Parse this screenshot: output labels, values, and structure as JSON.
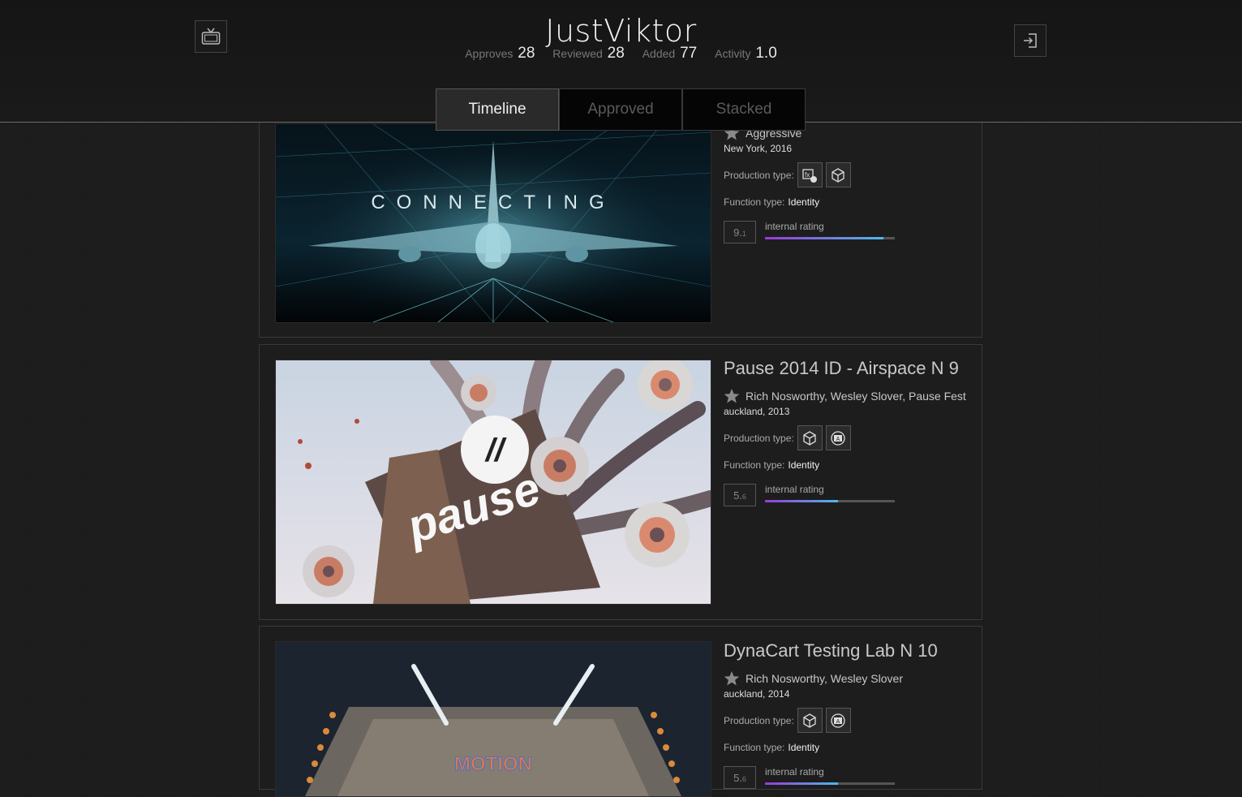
{
  "header": {
    "username": "JustViktor",
    "stats": [
      {
        "label": "Approves",
        "value": "28"
      },
      {
        "label": "Reviewed",
        "value": "28"
      },
      {
        "label": "Added",
        "value": "77"
      },
      {
        "label": "Activity",
        "value": "1.0"
      }
    ],
    "left_icon": "tv-icon",
    "right_icon": "login-icon"
  },
  "tabs": [
    "Timeline",
    "Approved",
    "Stacked"
  ],
  "active_tab": "Timeline",
  "labels": {
    "production_type": "Production type:",
    "function_type": "Function type:",
    "internal_rating": "internal rating"
  },
  "items": [
    {
      "title": "",
      "authors": "Aggressive",
      "place": "New York, 2016",
      "production_icons": [
        "fx-icon",
        "3d-cube-icon"
      ],
      "function_type": "Identity",
      "rating_major": "9.",
      "rating_minor": "1",
      "rating_value": 9.1,
      "thumbnail_text": "CONNECTING"
    },
    {
      "title": "Pause 2014 ID - Airspace N 9",
      "authors": "Rich Nosworthy, Wesley Slover, Pause Fest",
      "place": "auckland, 2013",
      "production_icons": [
        "3d-cube-icon",
        "after-effects-icon"
      ],
      "function_type": "Identity",
      "rating_major": "5.",
      "rating_minor": "6",
      "rating_value": 5.6,
      "thumbnail_text": "pause"
    },
    {
      "title": "DynaCart Testing Lab N 10",
      "authors": "Rich Nosworthy, Wesley Slover",
      "place": "auckland, 2014",
      "production_icons": [
        "3d-cube-icon",
        "after-effects-icon"
      ],
      "function_type": "Identity",
      "rating_major": "5.",
      "rating_minor": "6",
      "rating_value": 5.6,
      "thumbnail_text": "MOTION"
    }
  ]
}
